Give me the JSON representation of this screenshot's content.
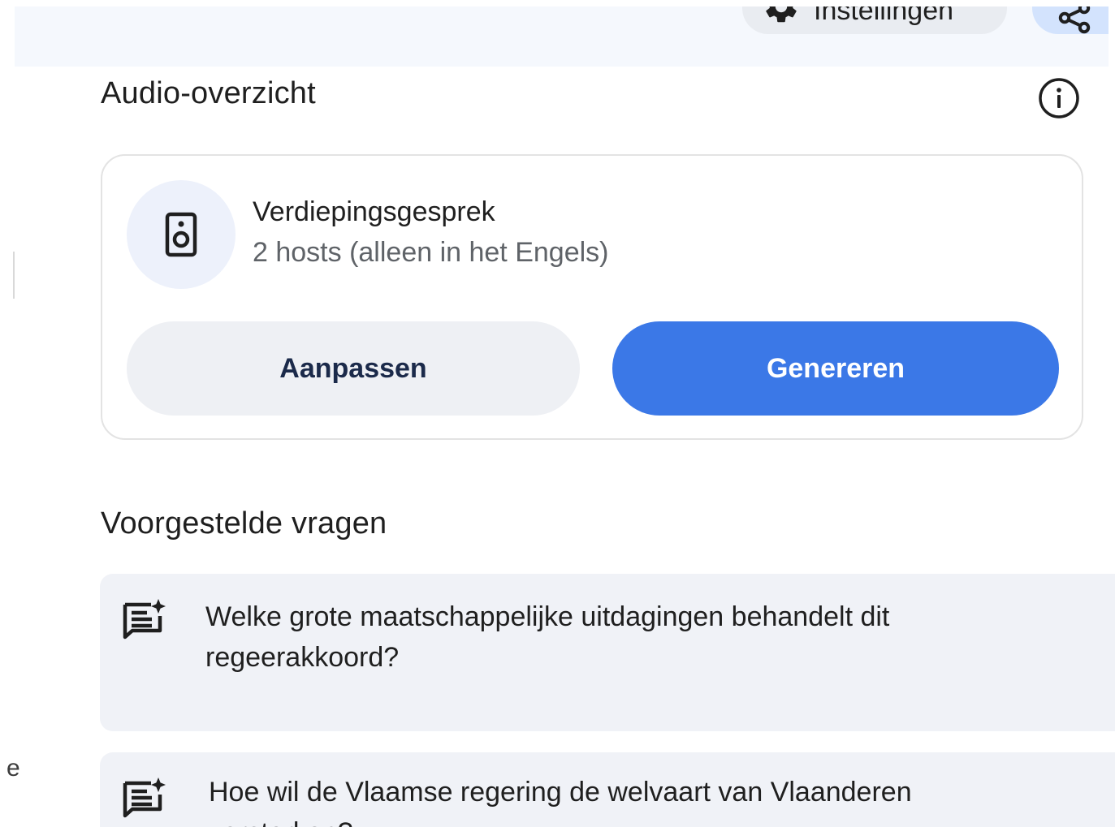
{
  "header": {
    "settings_label": "Instellingen"
  },
  "audio_overview": {
    "section_title": "Audio-overzicht",
    "card": {
      "title": "Verdiepingsgesprek",
      "subtitle": "2 hosts (alleen in het Engels)"
    },
    "customize_label": "Aanpassen",
    "generate_label": "Genereren"
  },
  "suggested_questions": {
    "section_title": "Voorgestelde vragen",
    "items": [
      {
        "text": "Welke grote maatschappelijke uitdagingen behandelt dit regeerakkoord?"
      },
      {
        "text": "Hoe wil de Vlaamse regering de welvaart van Vlaanderen versterken?"
      }
    ]
  },
  "edge": {
    "partial_char": "e"
  },
  "colors": {
    "accent_blue": "#3b78e7",
    "header_bg": "#f5f8fd",
    "question_bg": "#f0f2f7"
  },
  "icons": {
    "settings": "gear-icon",
    "share": "share-icon",
    "info": "info-icon",
    "speaker": "speaker-icon",
    "question": "chat-sparkle-icon"
  }
}
